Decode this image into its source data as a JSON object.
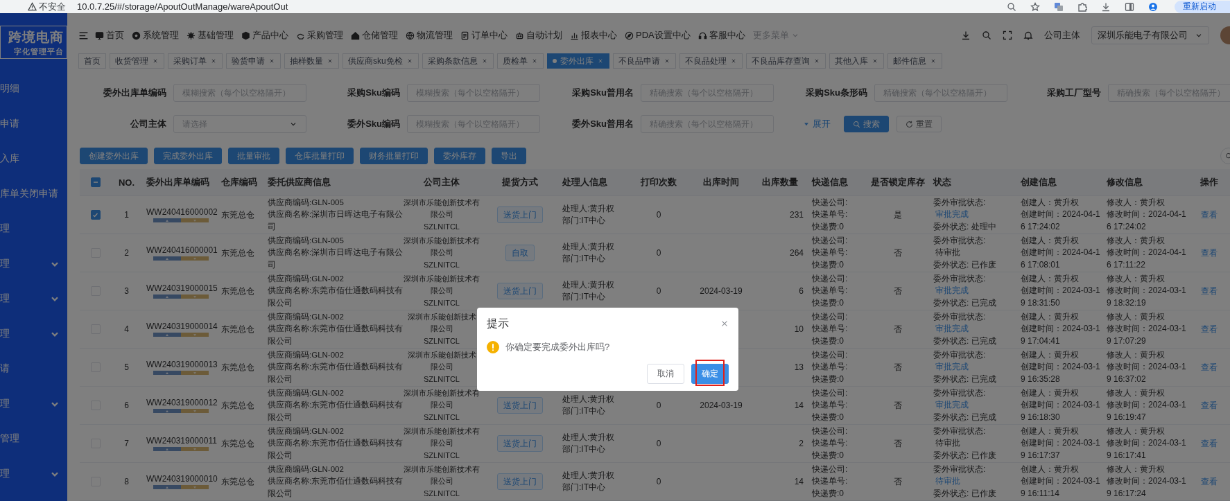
{
  "browser": {
    "security": "不安全",
    "url": "10.0.7.25/#/storage/ApoutOutManage/wareApoutOut",
    "restart_button": "重新启动"
  },
  "sidebar": {
    "logo_title": "跨境电商",
    "logo_subtitle": "字化管理平台",
    "items": [
      {
        "label": "明细",
        "expandable": false
      },
      {
        "label": "申请",
        "expandable": false
      },
      {
        "label": "入库",
        "expandable": false
      },
      {
        "label": "库单关闭申请",
        "expandable": false
      },
      {
        "label": "理",
        "expandable": false
      },
      {
        "label": "理",
        "expandable": true
      },
      {
        "label": "理",
        "expandable": true
      },
      {
        "label": "理",
        "expandable": true
      },
      {
        "label": "请",
        "expandable": false
      },
      {
        "label": "理",
        "expandable": true
      },
      {
        "label": "管理",
        "expandable": false
      },
      {
        "label": "理",
        "expandable": true
      }
    ]
  },
  "nav": {
    "items": [
      {
        "label": "首页",
        "kind": "link"
      },
      {
        "label": "系统管理",
        "kind": "link"
      },
      {
        "label": "基础管理",
        "kind": "link"
      },
      {
        "label": "产品中心",
        "kind": "link"
      },
      {
        "label": "采购管理",
        "kind": "link"
      },
      {
        "label": "仓储管理",
        "kind": "link"
      },
      {
        "label": "物流管理",
        "kind": "link"
      },
      {
        "label": "订单中心",
        "kind": "link"
      },
      {
        "label": "自动计划",
        "kind": "link"
      },
      {
        "label": "报表中心",
        "kind": "link"
      },
      {
        "label": "PDA设置中心",
        "kind": "link"
      },
      {
        "label": "客服中心",
        "kind": "link"
      },
      {
        "label": "更多菜单",
        "kind": "more"
      }
    ],
    "company_label": "公司主体",
    "company_value": "深圳乐能电子有限公司"
  },
  "tabs": [
    {
      "label": "首页",
      "selected": false,
      "closable": false
    },
    {
      "label": "收货管理",
      "selected": false,
      "closable": true
    },
    {
      "label": "采购订单",
      "selected": false,
      "closable": true
    },
    {
      "label": "验货申请",
      "selected": false,
      "closable": true
    },
    {
      "label": "抽样数量",
      "selected": false,
      "closable": true
    },
    {
      "label": "供应商sku免检",
      "selected": false,
      "closable": true
    },
    {
      "label": "采购条款信息",
      "selected": false,
      "closable": true
    },
    {
      "label": "质检单",
      "selected": false,
      "closable": true
    },
    {
      "label": "委外出库",
      "selected": true,
      "closable": true
    },
    {
      "label": "不良品申请",
      "selected": false,
      "closable": true
    },
    {
      "label": "不良品处理",
      "selected": false,
      "closable": true
    },
    {
      "label": "不良品库存查询",
      "selected": false,
      "closable": true
    },
    {
      "label": "其他入库",
      "selected": false,
      "closable": true
    },
    {
      "label": "邮件信息",
      "selected": false,
      "closable": true
    }
  ],
  "filters": [
    {
      "label": "委外出库单编码",
      "placeholder": "模糊搜索（每个以空格隔开）",
      "kind": "input"
    },
    {
      "label": "采购Sku编码",
      "placeholder": "模糊搜索（每个以空格隔开）",
      "kind": "input"
    },
    {
      "label": "采购Sku普用名",
      "placeholder": "精确搜索（每个以空格隔开）",
      "kind": "input"
    },
    {
      "label": "采购Sku条形码",
      "placeholder": "精确搜索（每个以空格隔开）",
      "kind": "input"
    },
    {
      "label": "采购工厂型号",
      "placeholder": "精确搜索（每个以空格隔开）",
      "kind": "input"
    },
    {
      "label": "公司主体",
      "placeholder": "请选择",
      "kind": "select"
    },
    {
      "label": "委外Sku编码",
      "placeholder": "模糊搜索（每个以空格隔开）",
      "kind": "input"
    },
    {
      "label": "委外Sku普用名",
      "placeholder": "精确搜索（每个以空格隔开）",
      "kind": "input"
    }
  ],
  "filter_actions": {
    "expand": "展开",
    "search": "搜索",
    "reset": "重置"
  },
  "actions": [
    "创建委外出库",
    "完成委外出库",
    "批量审批",
    "仓库批量打印",
    "财务批量打印",
    "委外库存",
    "导出"
  ],
  "table": {
    "select_all": {
      "indeterminate": true
    },
    "columns": [
      "NO.",
      "委外出库单编码",
      "仓库编码",
      "委托供应商信息",
      "公司主体",
      "提货方式",
      "处理人信息",
      "打印次数",
      "出库时间",
      "出库数量",
      "快递信息",
      "是否锁定库存",
      "状态",
      "创建信息",
      "修改信息",
      "操作"
    ],
    "rows": [
      {
        "selected": true,
        "no": "1",
        "code": "WW240416000002",
        "warehouse": "东莞总仓",
        "supplier": [
          "供应商编码:GLN-005",
          "供应商名称:深圳市日晖达电子有限公",
          "司"
        ],
        "company": [
          "深圳市乐能创新技术有",
          "限公司",
          "SZLNITCL"
        ],
        "pickup": "送货上门",
        "handler": [
          "处理人:黄升权",
          "部门:IT中心"
        ],
        "print_count": "0",
        "qty": "231",
        "express": [
          "快递公司:",
          "快递单号:",
          "快递费:0"
        ],
        "locked": "是",
        "approval_label": "委外审批状态:",
        "approval": "审批完成",
        "approval_link": true,
        "state": "委外状态: 处理中",
        "created": [
          "创建人：黄升权",
          "创建时间：2024-04-1",
          "6 17:24:02"
        ],
        "modified": [
          "修改人：黄升权",
          "修改时间：2024-04-1",
          "6 17:24:02"
        ],
        "action": "查看"
      },
      {
        "selected": false,
        "no": "2",
        "code": "WW240416000001",
        "warehouse": "东莞总仓",
        "supplier": [
          "供应商编码:GLN-005",
          "供应商名称:深圳市日晖达电子有限公",
          "司"
        ],
        "company": [
          "深圳市乐能创新技术有",
          "限公司",
          "SZLNITCL"
        ],
        "pickup": "自取",
        "handler": [
          "处理人:黄升权",
          "部门:IT中心"
        ],
        "print_count": "0",
        "qty": "264",
        "express": [
          "快递公司:",
          "快递单号:",
          "快递费:0"
        ],
        "locked": "否",
        "approval_label": "委外审批状态:",
        "approval": "待审批",
        "approval_link": false,
        "state": "委外状态: 已作废",
        "created": [
          "创建人：黄升权",
          "创建时间：2024-04-1",
          "6 17:08:01"
        ],
        "modified": [
          "修改人：黄升权",
          "修改时间：2024-04-1",
          "6 17:11:22"
        ],
        "action": "查看"
      },
      {
        "selected": false,
        "no": "3",
        "code": "WW240319000015",
        "warehouse": "东莞总仓",
        "supplier": [
          "供应商编码:GLN-002",
          "供应商名称:东莞市佰仕通数码科技有",
          "限公司"
        ],
        "company": [
          "深圳市乐能创新技术有",
          "限公司",
          "SZLNITCL"
        ],
        "pickup": "送货上门",
        "handler": [
          "处理人:黄升权",
          "部门:IT中心"
        ],
        "print_count": "0",
        "out_time": "2024-03-19",
        "qty": "6",
        "express": [
          "快递公司:",
          "快递单号:",
          "快递费:0"
        ],
        "locked": "否",
        "approval_label": "委外审批状态:",
        "approval": "审批完成",
        "approval_link": true,
        "state": "委外状态: 已完成",
        "created": [
          "创建人：黄升权",
          "创建时间：2024-03-1",
          "9 18:31:50"
        ],
        "modified": [
          "修改人：黄升权",
          "修改时间：2024-03-1",
          "9 18:32:19"
        ],
        "action": "查看"
      },
      {
        "selected": false,
        "no": "4",
        "code": "WW240319000014",
        "warehouse": "东莞总仓",
        "supplier": [
          "供应商编码:GLN-002",
          "供应商名称:东莞市佰仕通数码科技有",
          "限公司"
        ],
        "company": [
          "深圳市乐能创新技术",
          "限公司",
          "SZLNITCL"
        ],
        "qty": "10",
        "express": [
          "快递公司:",
          "快递单号:",
          "快递费:0"
        ],
        "locked": "否",
        "approval_label": "委外审批状态:",
        "approval": "审批完成",
        "approval_link": true,
        "state": "委外状态: 已完成",
        "created": [
          "创建人：黄升权",
          "创建时间：2024-03-1",
          "9 17:04:41"
        ],
        "modified": [
          "修改人：黄升权",
          "修改时间：2024-03-1",
          "9 17:07:29"
        ],
        "action": "查看"
      },
      {
        "selected": false,
        "no": "5",
        "code": "WW240319000013",
        "warehouse": "东莞总仓",
        "supplier": [
          "供应商编码:GLN-002",
          "供应商名称:东莞市佰仕通数码科技有",
          "限公司"
        ],
        "company": [
          "深圳市乐能创新技术",
          "限公司",
          "SZLNITCL"
        ],
        "qty": "13",
        "express": [
          "快递公司:",
          "快递单号:",
          "快递费:0"
        ],
        "locked": "否",
        "approval_label": "委外审批状态:",
        "approval": "审批完成",
        "approval_link": true,
        "state": "委外状态: 已完成",
        "created": [
          "创建人：黄升权",
          "创建时间：2024-03-1",
          "9 16:35:28"
        ],
        "modified": [
          "修改人：黄升权",
          "修改时间：2024-03-1",
          "9 16:37:02"
        ],
        "action": "查看"
      },
      {
        "selected": false,
        "no": "6",
        "code": "WW240319000012",
        "warehouse": "东莞总仓",
        "supplier": [
          "供应商编码:GLN-002",
          "供应商名称:东莞市佰仕通数码科技有",
          "限公司"
        ],
        "company": [
          "深圳市乐能创新技术有",
          "限公司",
          "SZLNITCL"
        ],
        "pickup": "送货上门",
        "handler": [
          "处理人:黄升权",
          "部门:IT中心"
        ],
        "print_count": "0",
        "out_time": "2024-03-19",
        "qty": "14",
        "express": [
          "快递公司:",
          "快递单号:",
          "快递费:0"
        ],
        "locked": "否",
        "approval_label": "委外审批状态:",
        "approval": "审批完成",
        "approval_link": true,
        "state": "委外状态: 已完成",
        "created": [
          "创建人：黄升权",
          "创建时间：2024-03-1",
          "9 16:18:30"
        ],
        "modified": [
          "修改人：黄升权",
          "修改时间：2024-03-1",
          "9 16:19:47"
        ],
        "action": "查看"
      },
      {
        "selected": false,
        "no": "7",
        "code": "WW240319000011",
        "warehouse": "东莞总仓",
        "supplier": [
          "供应商编码:GLN-002",
          "供应商名称:东莞市佰仕通数码科技有",
          "限公司"
        ],
        "company": [
          "深圳市乐能创新技术有",
          "限公司",
          "SZLNITCL"
        ],
        "pickup": "送货上门",
        "handler": [
          "处理人:黄升权",
          "部门:IT中心"
        ],
        "print_count": "0",
        "qty": "2",
        "express": [
          "快递公司:",
          "快递单号:",
          "快递费:0"
        ],
        "locked": "否",
        "approval_label": "委外审批状态:",
        "approval": "待审批",
        "approval_link": false,
        "state": "委外状态: 已作废",
        "created": [
          "创建人：黄升权",
          "创建时间：2024-03-1",
          "9 16:17:37"
        ],
        "modified": [
          "修改人：黄升权",
          "修改时间：2024-03-1",
          "9 16:17:41"
        ],
        "action": "查看"
      },
      {
        "selected": false,
        "no": "8",
        "code": "WW240319000010",
        "warehouse": "东莞总仓",
        "supplier": [
          "供应商编码:GLN-002",
          "供应商名称:东莞市佰仕通数码科技有",
          "限公司"
        ],
        "company": [
          "深圳市乐能创新技术有",
          "限公司",
          "SZLNITCL"
        ],
        "pickup": "送货上门",
        "handler": [
          "处理人:黄升权",
          "部门:IT中心"
        ],
        "print_count": "0",
        "qty": "14",
        "express": [
          "快递公司:",
          "快递单号:",
          "快递费:0"
        ],
        "locked": "否",
        "approval_label": "委外审批状态:",
        "approval": "待审批",
        "approval_link": true,
        "state": "委外状态: 已作废",
        "created": [
          "创建人：黄升权",
          "创建时间：2024-03-1",
          "9 16:11:14"
        ],
        "modified": [
          "修改人：黄升权",
          "修改时间：2024-03-1",
          "9 16:17:24"
        ],
        "action": "查看"
      }
    ]
  },
  "dialog": {
    "title": "提示",
    "message": "你确定要完成委外出库吗?",
    "cancel": "取消",
    "confirm": "确定",
    "confirm_highlighted": true
  }
}
